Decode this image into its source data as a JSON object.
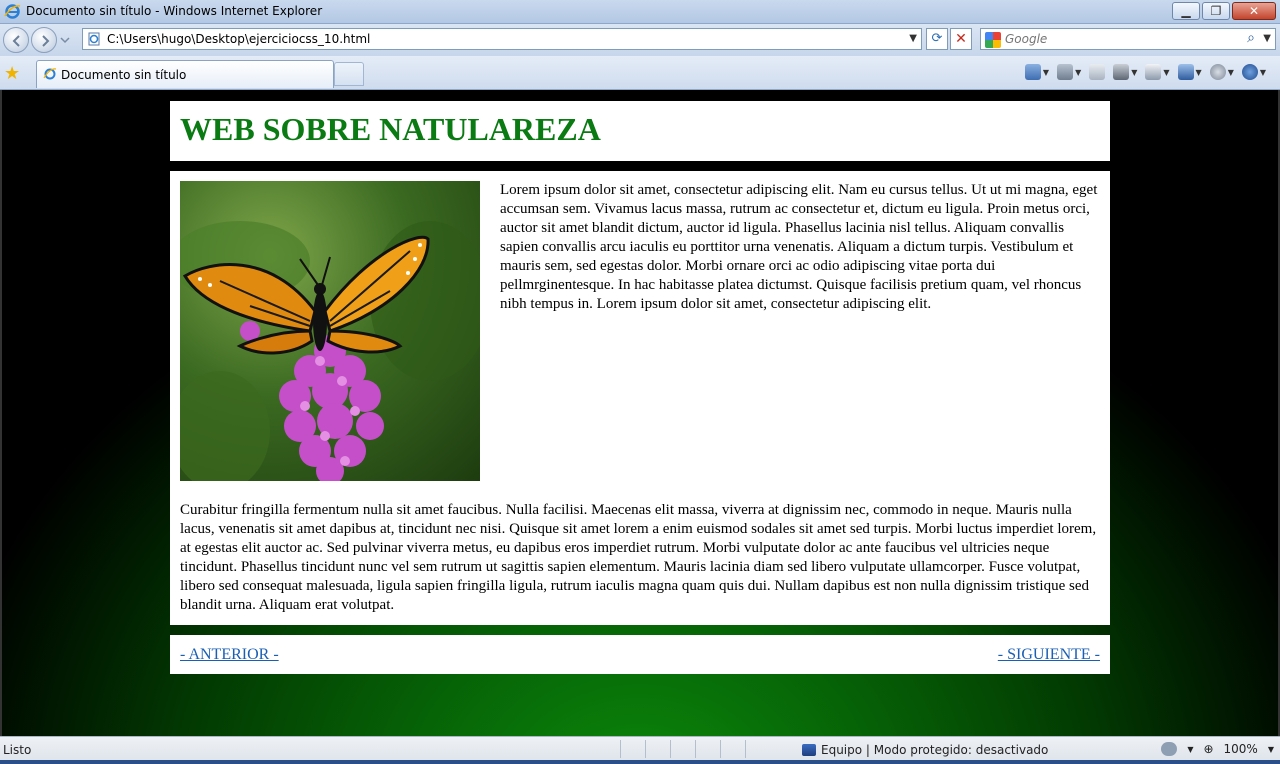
{
  "window": {
    "title": "Documento sin título - Windows Internet Explorer"
  },
  "navigation": {
    "url": "C:\\Users\\hugo\\Desktop\\ejerciciocss_10.html",
    "search_placeholder": "Google"
  },
  "tabs": [
    {
      "label": "Documento sin título"
    }
  ],
  "page": {
    "heading": "WEB SOBRE NATULAREZA",
    "image_alt": "butterfly-on-flowers",
    "paragraph1": "Lorem ipsum dolor sit amet, consectetur adipiscing elit. Nam eu cursus tellus. Ut ut mi magna, eget accumsan sem. Vivamus lacus massa, rutrum ac consectetur et, dictum eu ligula. Proin metus orci, auctor sit amet blandit dictum, auctor id ligula. Phasellus lacinia nisl tellus. Aliquam convallis sapien convallis arcu iaculis eu porttitor urna venenatis. Aliquam a dictum turpis. Vestibulum et mauris sem, sed egestas dolor. Morbi ornare orci ac odio adipiscing vitae porta dui pellmrginentesque. In hac habitasse platea dictumst. Quisque facilisis pretium quam, vel rhoncus nibh tempus in. Lorem ipsum dolor sit amet, consectetur adipiscing elit.",
    "paragraph2": "Curabitur fringilla fermentum nulla sit amet faucibus. Nulla facilisi. Maecenas elit massa, viverra at dignissim nec, commodo in neque. Mauris nulla lacus, venenatis sit amet dapibus at, tincidunt nec nisi. Quisque sit amet lorem a enim euismod sodales sit amet sed turpis. Morbi luctus imperdiet lorem, at egestas elit auctor ac. Sed pulvinar viverra metus, eu dapibus eros imperdiet rutrum. Morbi vulputate dolor ac ante faucibus vel ultricies neque tincidunt. Phasellus tincidunt nunc vel sem rutrum ut sagittis sapien elementum. Mauris lacinia diam sed libero vulputate ullamcorper. Fusce volutpat, libero sed consequat malesuada, ligula sapien fringilla ligula, rutrum iaculis magna quam quis dui. Nullam dapibus est non nulla dignissim tristique sed blandit urna. Aliquam erat volutpat.",
    "prev_link": "- ANTERIOR -",
    "next_link": "- SIGUIENTE -",
    "colors": {
      "heading": "#0a7a12",
      "link": "#1a5fb4",
      "background_center": "#0b8a0b",
      "background_edge": "#000000"
    }
  },
  "statusbar": {
    "status": "Listo",
    "zone": "Equipo | Modo protegido: desactivado",
    "zoom": "100%"
  },
  "icons": [
    "ie-logo-icon",
    "back-icon",
    "forward-icon",
    "page-icon",
    "refresh-icon",
    "stop-icon",
    "google-icon",
    "search-icon",
    "favorites-star-icon",
    "home-icon",
    "feeds-icon",
    "read-mail-icon",
    "print-icon",
    "page-menu-icon",
    "safety-icon",
    "tools-icon",
    "help-icon",
    "globe-icon",
    "zoom-icon"
  ]
}
